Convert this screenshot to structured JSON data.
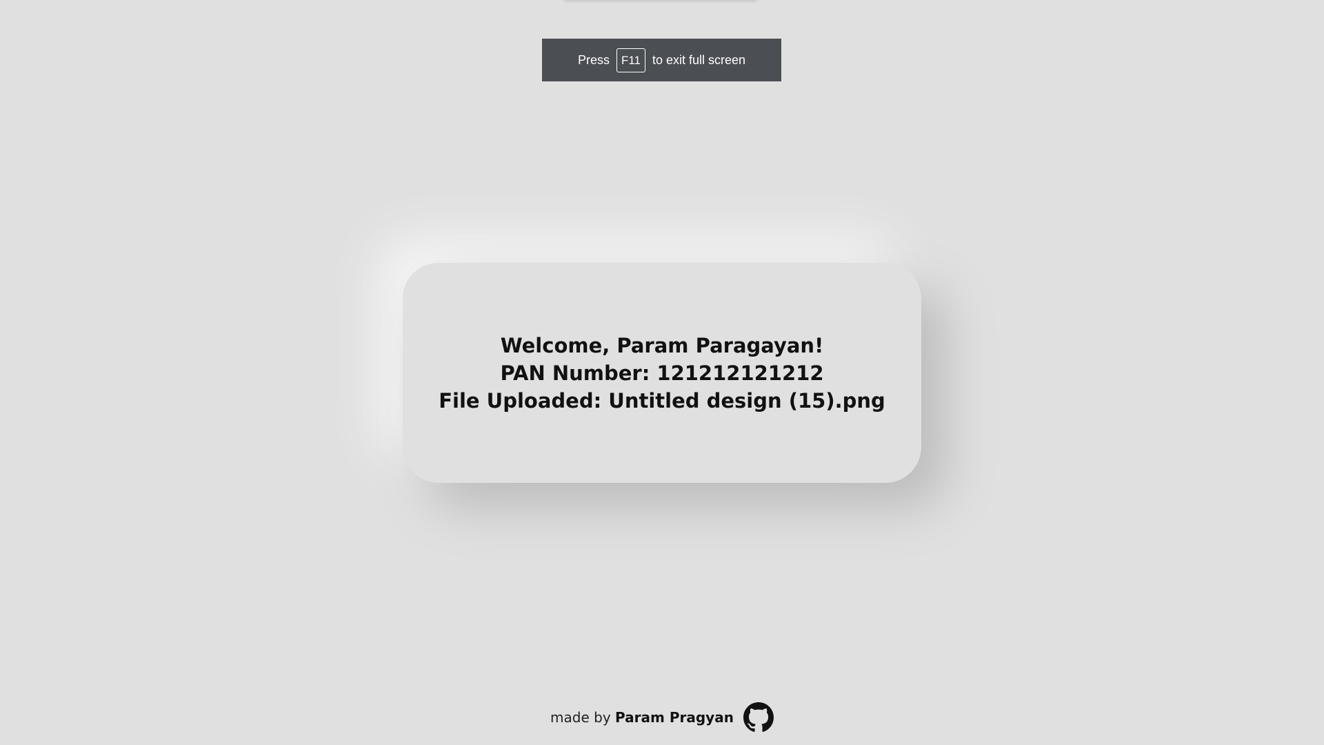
{
  "fullscreen_notice": {
    "prefix": "Press",
    "key": "F11",
    "suffix": "to exit full screen"
  },
  "card": {
    "welcome": "Welcome, Param Paragayan!",
    "pan": "PAN Number: 121212121212",
    "file": "File Uploaded: Untitled design (15).png"
  },
  "footer": {
    "made_by": "made by",
    "author": "Param Pragyan",
    "icon": "github-icon"
  },
  "colors": {
    "background": "#e0e0e0",
    "toast": "#4b4e52",
    "text": "#111111"
  }
}
